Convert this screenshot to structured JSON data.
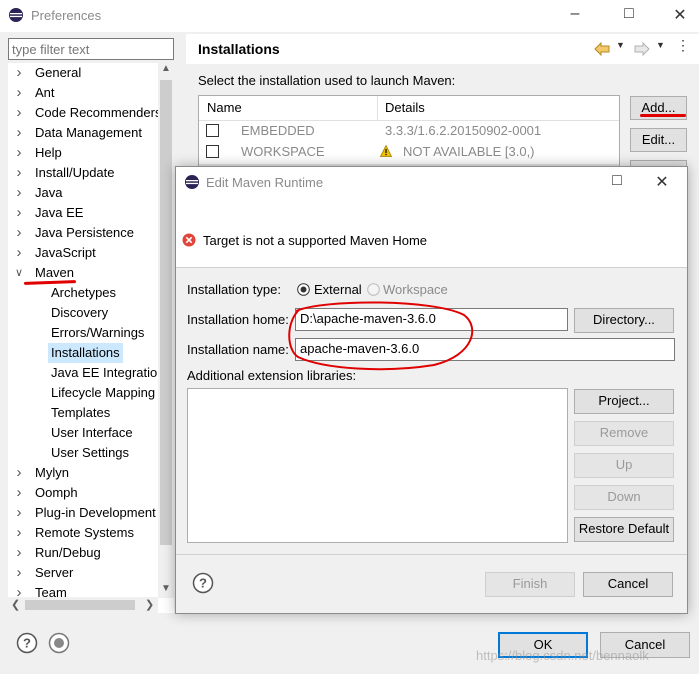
{
  "preferences": {
    "title": "Preferences",
    "filter_placeholder": "type filter text",
    "tree": [
      {
        "label": "General",
        "indent": 0,
        "state": "collapsed"
      },
      {
        "label": "Ant",
        "indent": 0,
        "state": "collapsed"
      },
      {
        "label": "Code Recommenders",
        "indent": 0,
        "state": "collapsed"
      },
      {
        "label": "Data Management",
        "indent": 0,
        "state": "collapsed"
      },
      {
        "label": "Help",
        "indent": 0,
        "state": "collapsed"
      },
      {
        "label": "Install/Update",
        "indent": 0,
        "state": "collapsed"
      },
      {
        "label": "Java",
        "indent": 0,
        "state": "collapsed"
      },
      {
        "label": "Java EE",
        "indent": 0,
        "state": "collapsed"
      },
      {
        "label": "Java Persistence",
        "indent": 0,
        "state": "collapsed"
      },
      {
        "label": "JavaScript",
        "indent": 0,
        "state": "collapsed"
      },
      {
        "label": "Maven",
        "indent": 0,
        "state": "expanded"
      },
      {
        "label": "Archetypes",
        "indent": 1,
        "state": "leaf"
      },
      {
        "label": "Discovery",
        "indent": 1,
        "state": "leaf"
      },
      {
        "label": "Errors/Warnings",
        "indent": 1,
        "state": "leaf"
      },
      {
        "label": "Installations",
        "indent": 1,
        "state": "selected"
      },
      {
        "label": "Java EE Integratio",
        "indent": 1,
        "state": "leaf"
      },
      {
        "label": "Lifecycle Mapping",
        "indent": 1,
        "state": "leaf"
      },
      {
        "label": "Templates",
        "indent": 1,
        "state": "leaf"
      },
      {
        "label": "User Interface",
        "indent": 1,
        "state": "leaf"
      },
      {
        "label": "User Settings",
        "indent": 1,
        "state": "leaf"
      },
      {
        "label": "Mylyn",
        "indent": 0,
        "state": "collapsed"
      },
      {
        "label": "Oomph",
        "indent": 0,
        "state": "collapsed"
      },
      {
        "label": "Plug-in Development",
        "indent": 0,
        "state": "collapsed"
      },
      {
        "label": "Remote Systems",
        "indent": 0,
        "state": "collapsed"
      },
      {
        "label": "Run/Debug",
        "indent": 0,
        "state": "collapsed"
      },
      {
        "label": "Server",
        "indent": 0,
        "state": "collapsed"
      },
      {
        "label": "Team",
        "indent": 0,
        "state": "collapsed"
      }
    ],
    "page_title": "Installations",
    "description": "Select the installation used to launch Maven:",
    "table_headers": [
      "Name",
      "Details"
    ],
    "table_rows": [
      {
        "name": "EMBEDDED",
        "details": "3.3.3/1.6.2.20150902-0001",
        "warning": false
      },
      {
        "name": "WORKSPACE",
        "details": "NOT AVAILABLE [3.0,)",
        "warning": true
      }
    ],
    "add_button": "Add...",
    "edit_button": "Edit...",
    "ok_button": "OK",
    "cancel_button": "Cancel",
    "watermark": "https://blog.csdn.net/bennaolk"
  },
  "dialog": {
    "title": "Edit Maven Runtime",
    "error_message": "Target is not a supported Maven Home",
    "installation_type_label": "Installation type:",
    "type_external": "External",
    "type_workspace": "Workspace",
    "home_label": "Installation home:",
    "home_value": "D:\\apache-maven-3.6.0",
    "name_label": "Installation name:",
    "name_value": "apache-maven-3.6.0",
    "ext_libs_label": "Additional extension libraries:",
    "directory_button": "Directory...",
    "project_button": "Project...",
    "remove_button": "Remove",
    "up_button": "Up",
    "down_button": "Down",
    "restore_button": "Restore Default",
    "finish_button": "Finish",
    "cancel_button": "Cancel"
  },
  "colors": {
    "annotation_red": "#e00000",
    "selected_bg": "#cce8ff",
    "error_red": "#e0453b",
    "warning_yellow": "#f2c200",
    "accent_blue": "#0078d7"
  }
}
